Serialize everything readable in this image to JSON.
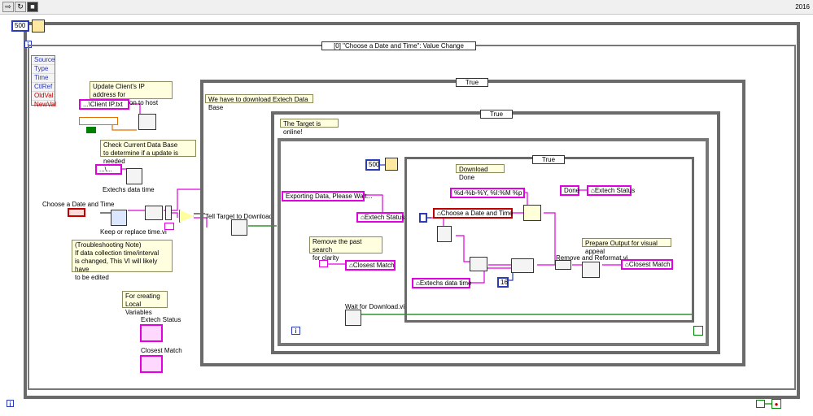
{
  "toolbar": {
    "version": "2016"
  },
  "outer_loop": {
    "wait_ms": "500",
    "iteration_icon": "i"
  },
  "event_structure": {
    "case_label": "[0] \"Choose a Date and Time\": Value Change",
    "event_data": [
      "Source",
      "Type",
      "Time",
      "CtlRef",
      "OldVal",
      "NewVal"
    ]
  },
  "notes": {
    "update_ip": "Update Client's IP address for\ncommunication to host",
    "check_db": "Check Current Data Base\nto determine if a update is needed",
    "troubleshooting": "(Troubleshooting Note)\nIf data collection time/interval\n is changed, This VI will likely have\nto be edited",
    "local_vars": "For creating\nLocal Variables",
    "download_extech": "We have to download Extech Data Base",
    "target_online": "The Target is online!",
    "remove_past": "Remove the past search\nfor clarity",
    "download_done": "Download Done",
    "prepare_output": "Prepare Output for visual appeal"
  },
  "constants": {
    "client_ip_path": "...\\Client IP.txt",
    "extech_path": "...\\...",
    "exporting": "Exporting Data, Please Wait...",
    "date_format": "%d-%b-%Y, %I:%M %p",
    "done": "Done",
    "sixteen": "16",
    "inner_wait": "500"
  },
  "labels": {
    "choose_date_time": "Choose a Date and Time",
    "keep_replace": "Keep or replace time.vi",
    "extechs_data_time": "Extechs data time",
    "tell_target": "Tell Target to Download",
    "wait_download": "Wait for Download.vi",
    "remove_reformat": "Remove and Reformat.vi",
    "extech_status": "Extech Status",
    "closest_match": "Closest Match"
  },
  "local_variables": {
    "extech_status": "Extech Status",
    "closest_match": "Closest Match",
    "choose_date_time": "Choose a Date and Time",
    "extechs_data_time": "Extechs data time"
  },
  "case_selectors": {
    "outer": "True",
    "middle": "True",
    "inner": "True"
  },
  "colors": {
    "string_wire": "#e000e0",
    "bool_wire": "#008000",
    "numeric_wire": "#2a3ab8",
    "note_bg": "#ffffe0"
  }
}
